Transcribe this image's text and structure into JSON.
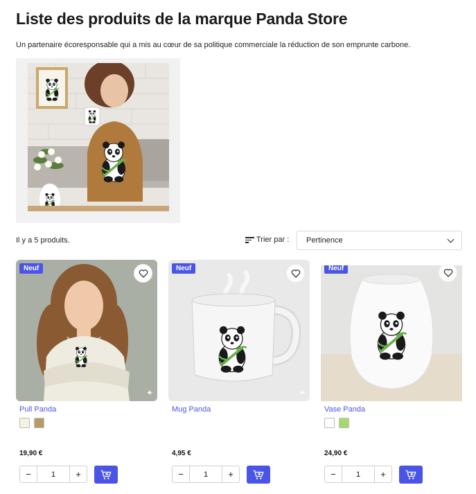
{
  "page": {
    "title": "Liste des produits de la marque Panda Store",
    "description": "Un partenaire écoresponsable qui a mis au cœur de sa politique commerciale la réduction de son emprunte carbone."
  },
  "listing": {
    "count_text": "Il y a 5 produits.",
    "sort_label": "Trier par :",
    "sort_value": "Pertinence"
  },
  "colors": {
    "accent": "#4a55e8"
  },
  "products": [
    {
      "badge": "Neuf",
      "name": "Pull Panda",
      "price": "19,90 €",
      "quantity": "1",
      "swatches": [
        "#f5f3df",
        "#b89a64"
      ]
    },
    {
      "badge": "Neuf",
      "name": "Mug Panda",
      "price": "4,95 €",
      "quantity": "1",
      "swatches": []
    },
    {
      "badge": "Neuf",
      "name": "Vase Panda",
      "price": "24,90 €",
      "quantity": "1",
      "swatches": [
        "#ffffff",
        "#a6d86e"
      ]
    }
  ],
  "icons": {
    "favorite": "heart-icon",
    "sort": "sort-lines-icon",
    "dropdown": "chevron-down-icon",
    "decrement": "minus-icon",
    "increment": "plus-icon",
    "add_to_cart": "cart-plus-icon"
  },
  "qty_controls": {
    "minus": "−",
    "plus": "+"
  }
}
